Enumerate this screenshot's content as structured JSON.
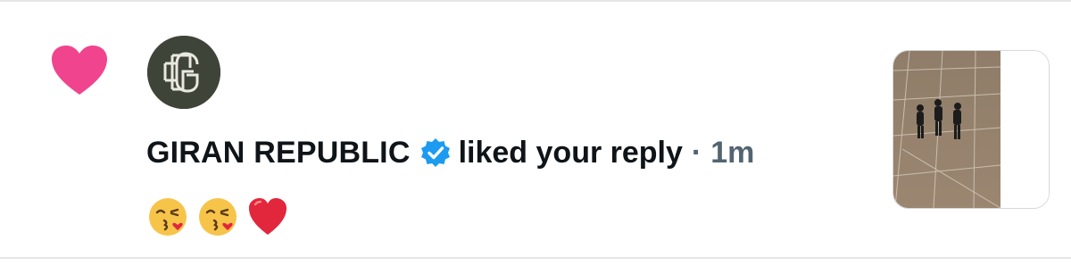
{
  "notification": {
    "user_name": "GIRAN REPUBLIC",
    "action": "liked your reply",
    "separator": "·",
    "time": "1m",
    "icons": {
      "like": "heart-icon",
      "verified": "verified-badge-icon",
      "avatar": "giran-republic-monogram-avatar"
    },
    "reply_emojis": [
      "kissing-face-with-heart-icon",
      "kissing-face-with-heart-icon",
      "red-heart-icon"
    ],
    "colors": {
      "like_heart": "#f0448f",
      "verified": "#1d9bf0",
      "text_primary": "#0f1419",
      "text_secondary": "#536471",
      "avatar_bg": "#3f4438"
    }
  }
}
